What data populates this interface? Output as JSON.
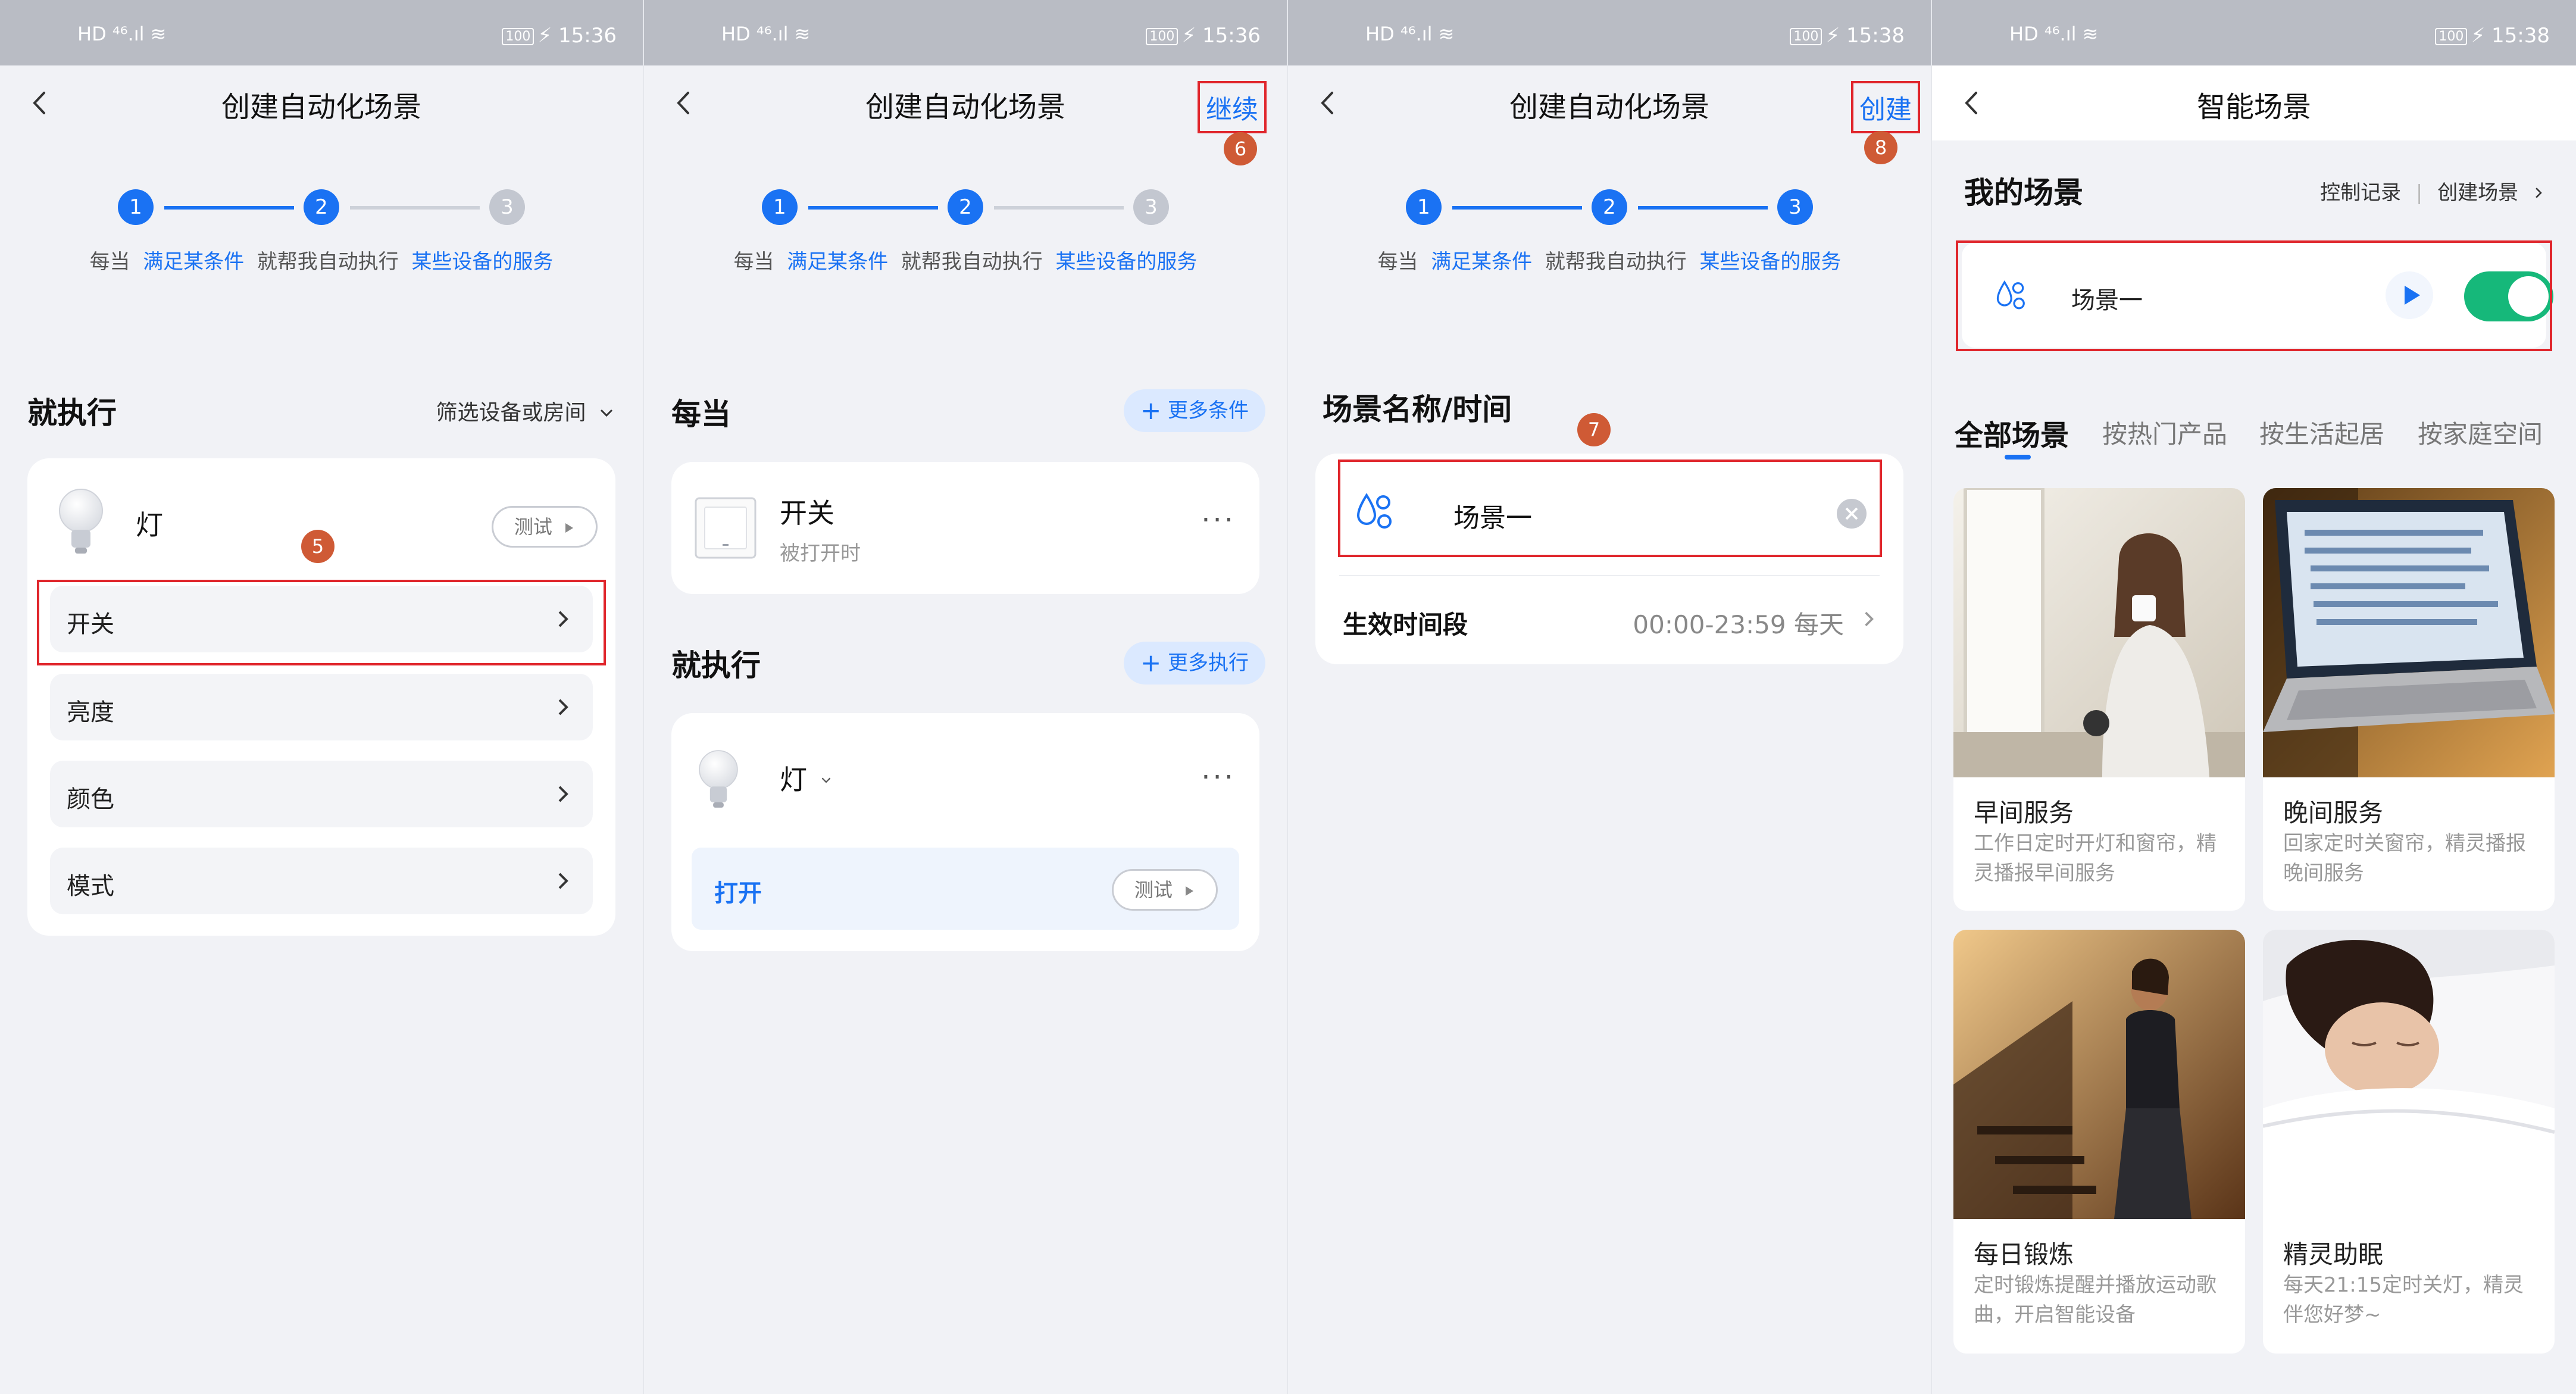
{
  "status": {
    "left_icons": "HD ⁴⁶.ıl ≋",
    "battery": "100",
    "charging": "⚡",
    "times": [
      "15:36",
      "15:36",
      "15:38",
      "15:38"
    ]
  },
  "panel1": {
    "title": "创建自动化场景",
    "steps": [
      "1",
      "2",
      "3"
    ],
    "desc_prefix": "每当",
    "desc_cond": "满足某条件",
    "desc_mid": "就帮我自动执行",
    "desc_service": "某些设备的服务",
    "section": "就执行",
    "filter": "筛选设备或房间",
    "device_name": "灯",
    "test_label": "测试",
    "badge": "5",
    "rows": [
      "开关",
      "亮度",
      "颜色",
      "模式"
    ]
  },
  "panel2": {
    "title": "创建自动化场景",
    "action": "继续",
    "badge": "6",
    "steps": [
      "1",
      "2",
      "3"
    ],
    "desc_prefix": "每当",
    "desc_cond": "满足某条件",
    "desc_mid": "就帮我自动执行",
    "desc_service": "某些设备的服务",
    "when_section": "每当",
    "more_conditions": "更多条件",
    "switch_name": "开关",
    "switch_sub": "被打开时",
    "exec_section": "就执行",
    "more_exec": "更多执行",
    "device_name": "灯",
    "action_label": "打开",
    "test_label": "测试"
  },
  "panel3": {
    "title": "创建自动化场景",
    "action": "创建",
    "badge_create": "8",
    "steps": [
      "1",
      "2",
      "3"
    ],
    "desc_prefix": "每当",
    "desc_cond": "满足某条件",
    "desc_mid": "就帮我自动执行",
    "desc_service": "某些设备的服务",
    "section": "场景名称/时间",
    "badge_name": "7",
    "scene_name": "场景一",
    "time_label": "生效时间段",
    "time_value": "00:00-23:59 每天"
  },
  "panel4": {
    "title": "智能场景",
    "my_scenes": "我的场景",
    "control_log": "控制记录",
    "create_scene": "创建场景",
    "scene_name": "场景一",
    "scene_enabled": true,
    "tabs": [
      "全部场景",
      "按热门产品",
      "按生活起居",
      "按家庭空间"
    ],
    "cards": [
      {
        "title": "早间服务",
        "desc": "工作日定时开灯和窗帘，精灵播报早间服务"
      },
      {
        "title": "晚间服务",
        "desc": "回家定时关窗帘，精灵播报晚间服务"
      },
      {
        "title": "每日锻炼",
        "desc": "定时锻炼提醒并播放运动歌曲，开启智能设备"
      },
      {
        "title": "精灵助眠",
        "desc": "每天21:15定时关灯，精灵伴您好梦~"
      }
    ]
  },
  "colors": {
    "accent": "#1a72f3",
    "highlight_box": "#e0262c",
    "badge": "#cf5a35",
    "toggle_on": "#16b87a"
  }
}
